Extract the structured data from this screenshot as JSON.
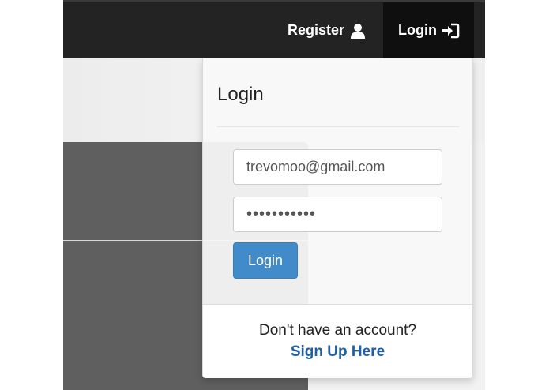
{
  "navbar": {
    "register_label": "Register",
    "login_label": "Login",
    "register_icon": "user-icon",
    "login_icon": "sign-in-icon"
  },
  "login_dropdown": {
    "title": "Login",
    "email": {
      "value": "trevomoo@gmail.com"
    },
    "password": {
      "value": "•••••••••••"
    },
    "submit_label": "Login",
    "footer_text": "Don't have an account?",
    "signup_link": "Sign Up Here"
  },
  "colors": {
    "navbar_bg": "#232323",
    "navbar_active_bg": "#0f0f0f",
    "primary_button": "#428bca",
    "link": "#1f5fa8"
  }
}
